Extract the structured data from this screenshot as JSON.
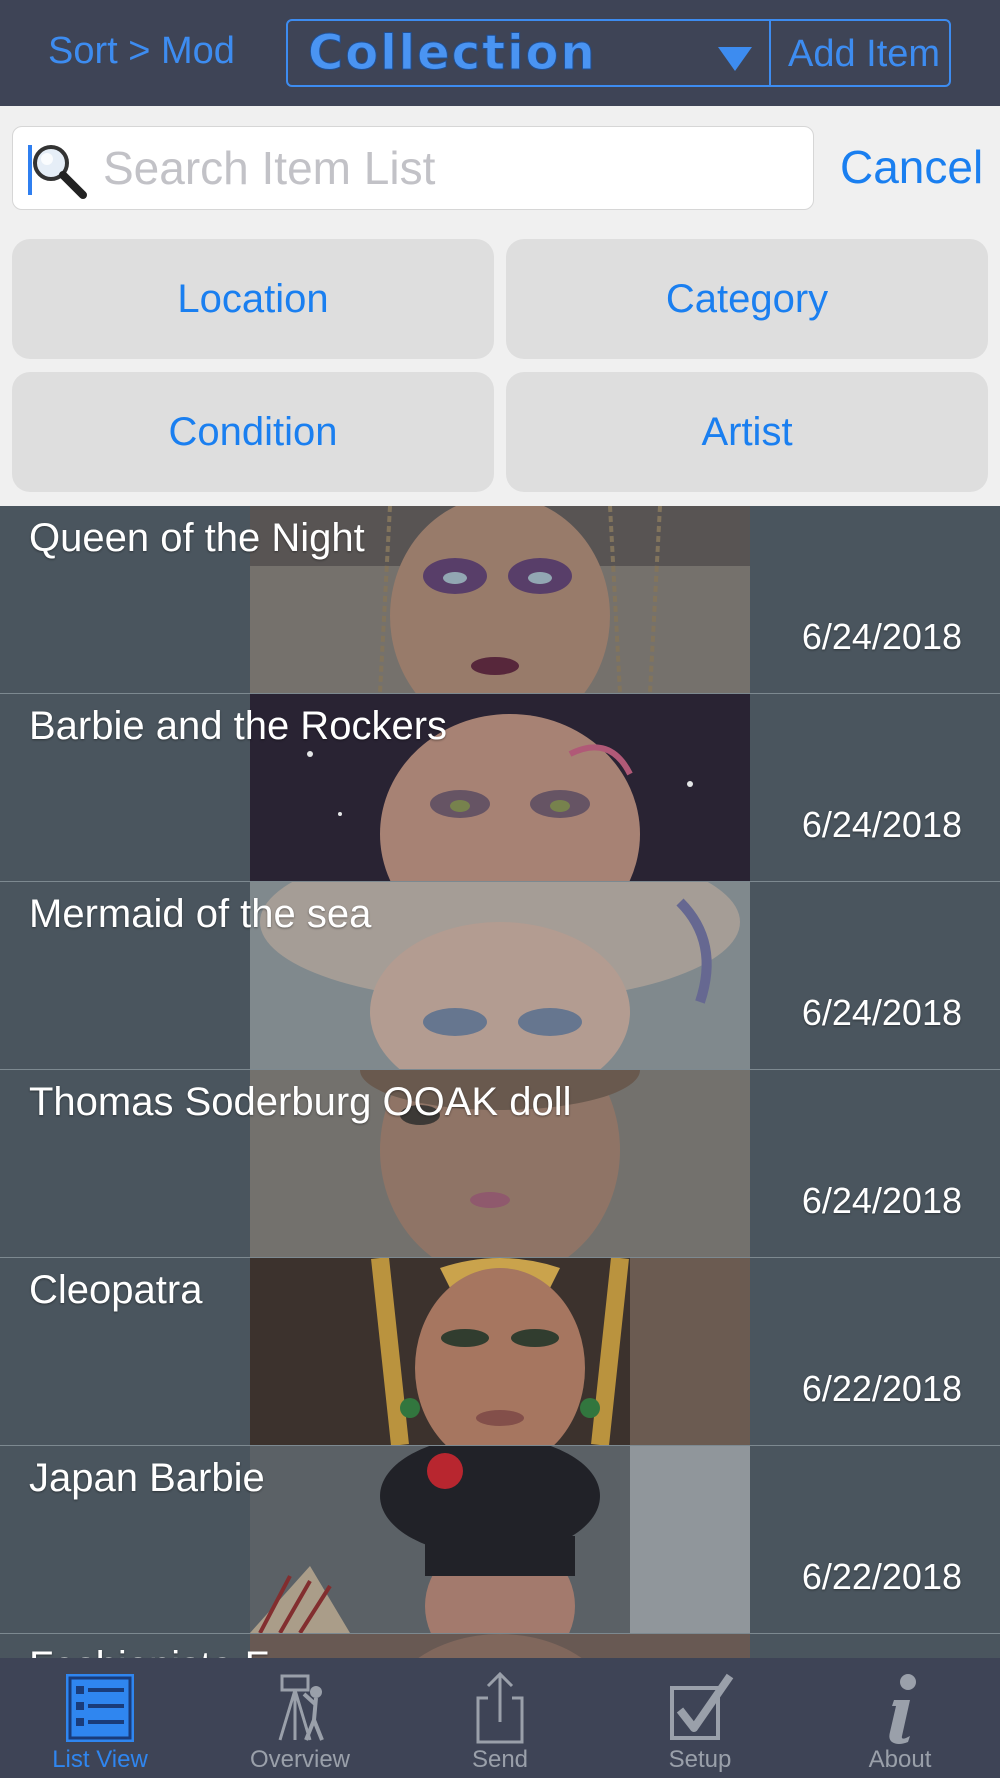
{
  "header": {
    "sort_label": "Sort > Mod",
    "collection_title": "Collection",
    "add_item_label": "Add Item"
  },
  "search": {
    "placeholder": "Search Item List",
    "cancel_label": "Cancel"
  },
  "filters": [
    "Location",
    "Category",
    "Condition",
    "Artist"
  ],
  "items": [
    {
      "title": "Queen of the Night",
      "date": "6/24/2018"
    },
    {
      "title": "Barbie and the Rockers",
      "date": "6/24/2018"
    },
    {
      "title": "Mermaid of the sea",
      "date": "6/24/2018"
    },
    {
      "title": "Thomas Soderburg OOAK doll",
      "date": "6/24/2018"
    },
    {
      "title": "Cleopatra",
      "date": "6/22/2018"
    },
    {
      "title": "Japan Barbie",
      "date": "6/22/2018"
    },
    {
      "title": "Fashionista F",
      "date": ""
    }
  ],
  "tabs": [
    {
      "label": "List View",
      "icon": "list-icon",
      "active": true
    },
    {
      "label": "Overview",
      "icon": "tripod-camera-icon",
      "active": false
    },
    {
      "label": "Send",
      "icon": "share-icon",
      "active": false
    },
    {
      "label": "Setup",
      "icon": "checkbox-icon",
      "active": false
    },
    {
      "label": "About",
      "icon": "info-icon",
      "active": false
    }
  ],
  "colors": {
    "accent": "#1a7ff0",
    "header_bg": "#3e4456",
    "list_bg": "#4a555e",
    "tab_inactive": "#9aa0aa"
  }
}
